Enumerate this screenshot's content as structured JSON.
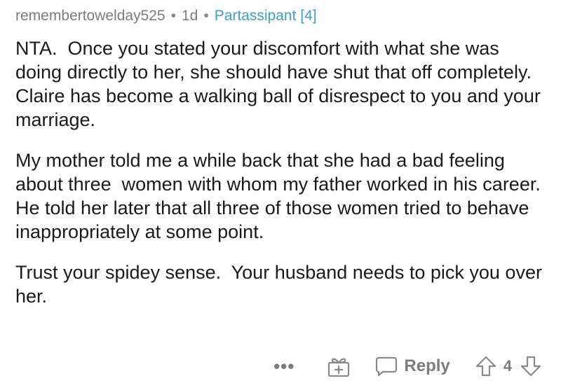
{
  "comment": {
    "username": "remembertowelday525",
    "separator": "•",
    "age": "1d",
    "flair": "Partassipant [4]",
    "paragraphs": [
      "NTA.  Once you stated your discomfort with what she was doing directly to her, she should have shut that off completely. Claire has become a walking ball of disrespect to you and your marriage.",
      "My mother told me a while back that she had a bad feeling about three  women with whom my father worked in his career.   He told her later that all three of those women tried to behave inappropriately at some point.",
      "Trust your spidey sense.  Your husband needs to pick you over her."
    ]
  },
  "actions": {
    "more_icon": "more-options-icon",
    "more_label": "•••",
    "award_icon": "gift-award-icon",
    "reply_icon": "speech-bubble-icon",
    "reply_label": "Reply",
    "upvote_icon": "arrow-up-outline-icon",
    "score": "4",
    "downvote_icon": "arrow-down-outline-icon"
  },
  "colors": {
    "text": "#1a1a1b",
    "meta": "#7c7c7c",
    "flair": "#3aa0c8",
    "icon": "#878a8c",
    "background": "#ffffff"
  }
}
